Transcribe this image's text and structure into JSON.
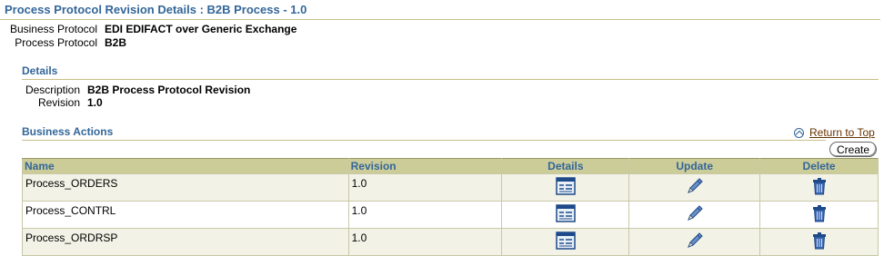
{
  "page": {
    "title": "Process Protocol Revision Details : B2B Process - 1.0"
  },
  "header_fields": [
    {
      "label": "Business Protocol",
      "value": "EDI EDIFACT over Generic Exchange"
    },
    {
      "label": "Process Protocol",
      "value": "B2B"
    }
  ],
  "details": {
    "title": "Details",
    "fields": [
      {
        "label": "Description",
        "value": "B2B Process Protocol Revision"
      },
      {
        "label": "Revision",
        "value": "1.0"
      }
    ]
  },
  "business_actions": {
    "title": "Business Actions",
    "return_to_top": "Return to Top",
    "create_label": "Create",
    "columns": [
      "Name",
      "Revision",
      "Details",
      "Update",
      "Delete"
    ],
    "rows": [
      {
        "name": "Process_ORDERS",
        "revision": "1.0"
      },
      {
        "name": "Process_CONTRL",
        "revision": "1.0"
      },
      {
        "name": "Process_ORDRSP",
        "revision": "1.0"
      }
    ]
  },
  "icons": {
    "details": "details-icon",
    "update": "pencil-icon",
    "delete": "trash-icon",
    "return_to_top": "up-arrow-icon"
  },
  "colors": {
    "title": "#336699",
    "table_header_bg": "#cccc99",
    "row_alt_bg": "#f2f2e6",
    "link": "#663300"
  }
}
